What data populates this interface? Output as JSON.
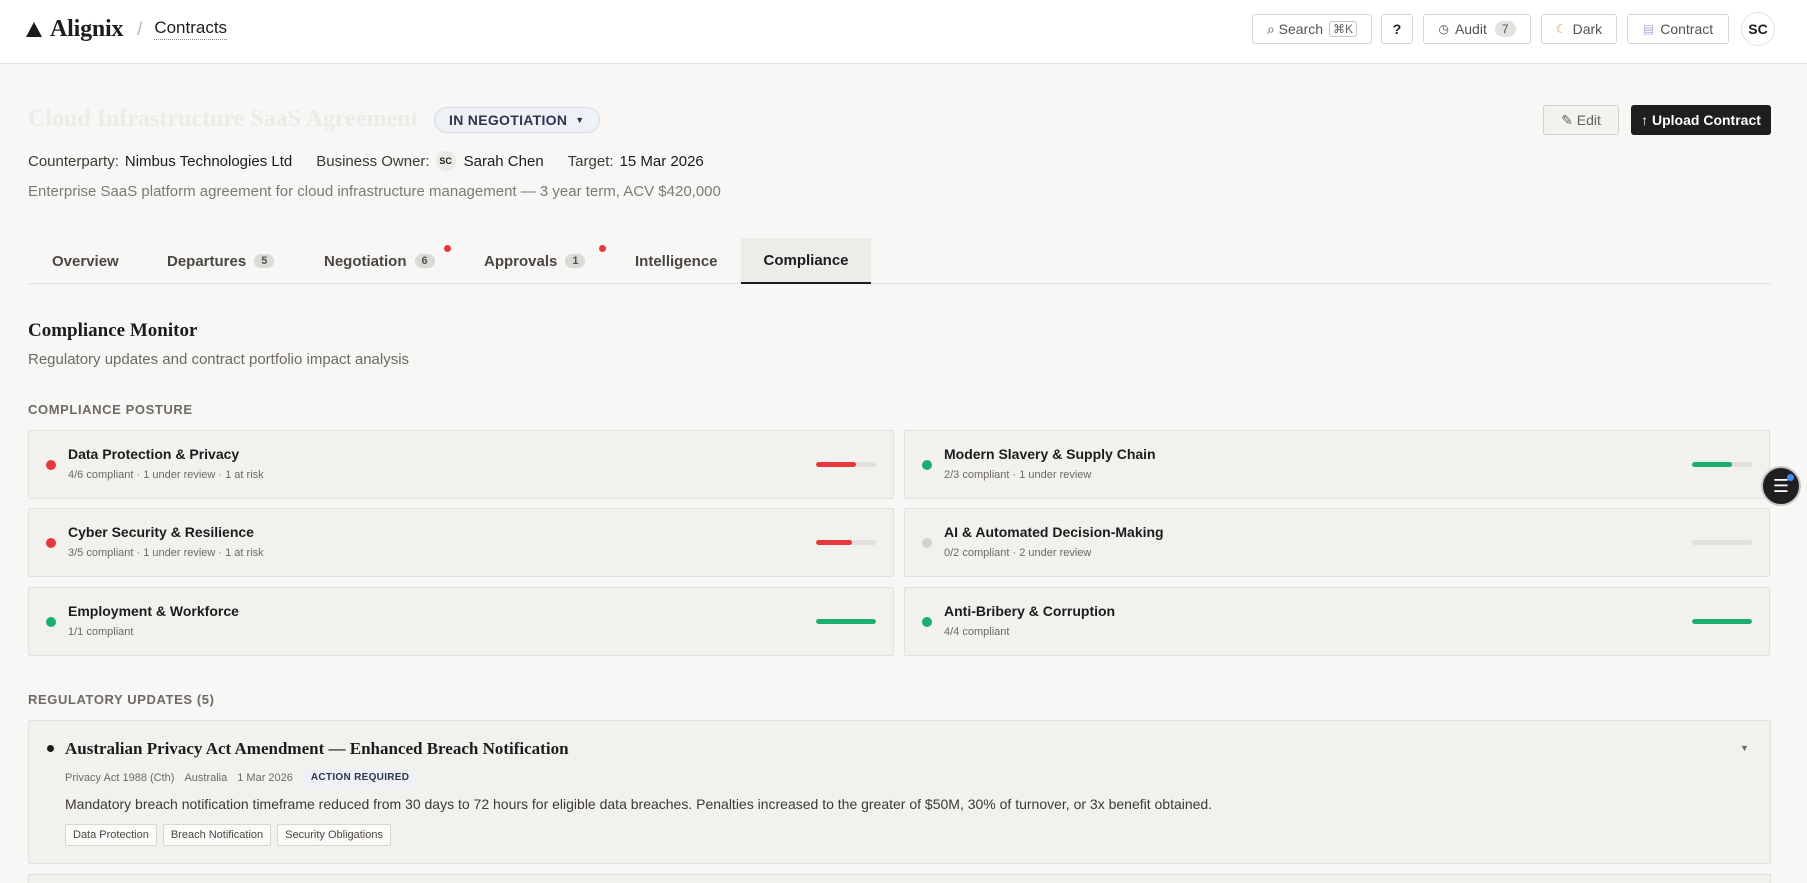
{
  "header": {
    "brand": "Alignix",
    "crumb_sep": "/",
    "crumb": "Contracts",
    "search_label": "⌕ Search",
    "search_kbd": "⌘K",
    "help_label": "?",
    "audit_label": "Audit",
    "audit_count": "7",
    "dark_label": "Dark",
    "contract_label": "Contract",
    "avatar": "SC"
  },
  "contract": {
    "title": "Cloud Infrastructure SaaS Agreement",
    "status": "IN NEGOTIATION",
    "edit_label": "✎ Edit",
    "upload_label": "↑ Upload Contract",
    "counterparty_label": "Counterparty:",
    "counterparty": "Nimbus Technologies Ltd",
    "owner_label": "Business Owner:",
    "owner_initials": "SC",
    "owner": "Sarah Chen",
    "target_label": "Target:",
    "target": "15 Mar 2026",
    "description": "Enterprise SaaS platform agreement for cloud infrastructure management — 3 year term, ACV $420,000"
  },
  "tabs": [
    {
      "label": "Overview",
      "count": ""
    },
    {
      "label": "Departures",
      "count": "5"
    },
    {
      "label": "Negotiation",
      "count": "6"
    },
    {
      "label": "Approvals",
      "count": "1"
    },
    {
      "label": "Intelligence",
      "count": ""
    },
    {
      "label": "Compliance",
      "count": ""
    }
  ],
  "compliance": {
    "title": "Compliance Monitor",
    "subtitle": "Regulatory updates and contract portfolio impact analysis",
    "posture_label": "COMPLIANCE POSTURE",
    "areas": [
      {
        "name": "Data Protection & Privacy",
        "meta": "4/6 compliant · 1 under review · 1 at risk",
        "level": 0.67,
        "color": "#e5383b"
      },
      {
        "name": "Modern Slavery & Supply Chain",
        "meta": "2/3 compliant · 1 under review",
        "level": 0.67,
        "color": "#1aae6f"
      },
      {
        "name": "Cyber Security & Resilience",
        "meta": "3/5 compliant · 1 under review · 1 at risk",
        "level": 0.6,
        "color": "#e5383b"
      },
      {
        "name": "AI & Automated Decision-Making",
        "meta": "0/2 compliant · 2 under review",
        "level": 0,
        "color": "#d3d1cd"
      },
      {
        "name": "Employment & Workforce",
        "meta": "1/1 compliant",
        "level": 1,
        "color": "#1aae6f"
      },
      {
        "name": "Anti-Bribery & Corruption",
        "meta": "4/4 compliant",
        "level": 1,
        "color": "#1aae6f"
      }
    ],
    "updates_label": "REGULATORY UPDATES (5)",
    "update": {
      "title": "Australian Privacy Act Amendment — Enhanced Breach Notification",
      "source": "Privacy Act 1988 (Cth)",
      "jurisdiction": "Australia",
      "date": "1 Mar 2026",
      "flag": "ACTION REQUIRED",
      "body": "Mandatory breach notification timeframe reduced from 30 days to 72 hours for eligible data breaches. Penalties increased to the greater of $50M, 30% of turnover, or 3x benefit obtained.",
      "tags": [
        "Data Protection",
        "Breach Notification",
        "Security Obligations"
      ]
    }
  }
}
